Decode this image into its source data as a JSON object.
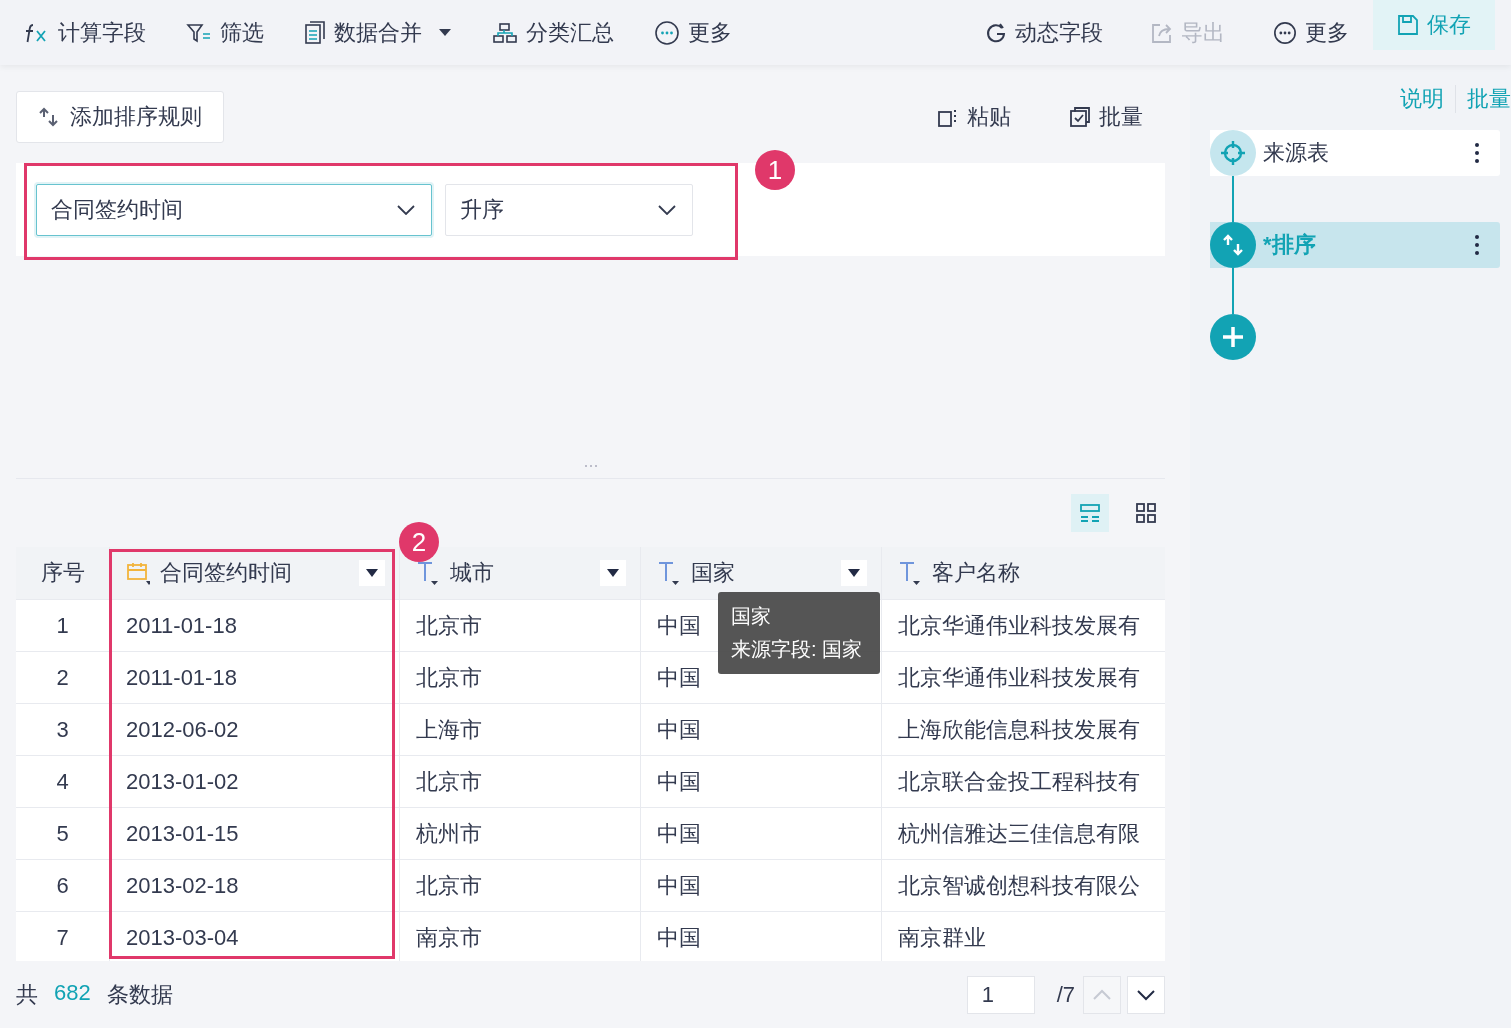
{
  "toolbar": {
    "left": [
      {
        "label": "计算字段",
        "dropdown": false
      },
      {
        "label": "筛选",
        "dropdown": false
      },
      {
        "label": "数据合并",
        "dropdown": true
      },
      {
        "label": "分类汇总",
        "dropdown": false
      },
      {
        "label": "更多",
        "dropdown": false
      }
    ],
    "right": [
      {
        "label": "动态字段",
        "disabled": false,
        "kind": "plain"
      },
      {
        "label": "导出",
        "disabled": true,
        "kind": "plain"
      },
      {
        "label": "更多",
        "disabled": false,
        "kind": "plain"
      },
      {
        "label": "保存",
        "disabled": false,
        "kind": "primary"
      }
    ]
  },
  "sort_panel": {
    "add_rule_button": "添加排序规则",
    "actions": [
      "粘贴",
      "批量"
    ],
    "rules": [
      {
        "field": {
          "value": "合同签约时间",
          "focused": true
        },
        "order": {
          "value": "升序",
          "focused": false
        }
      }
    ]
  },
  "view_toggles": [
    {
      "selected": true
    },
    {
      "selected": false
    }
  ],
  "table": {
    "columns": [
      {
        "label": "序号",
        "kind": "index",
        "menu": false
      },
      {
        "label": "合同签约时间",
        "kind": "date",
        "menu": true
      },
      {
        "label": "城市",
        "kind": "text",
        "menu": true
      },
      {
        "label": "国家",
        "kind": "text",
        "menu": true
      },
      {
        "label": "客户名称",
        "kind": "text",
        "menu": false
      }
    ],
    "rows": [
      [
        "1",
        "2011-01-18",
        "北京市",
        "中国",
        "北京华通伟业科技发展有"
      ],
      [
        "2",
        "2011-01-18",
        "北京市",
        "中国",
        "北京华通伟业科技发展有"
      ],
      [
        "3",
        "2012-06-02",
        "上海市",
        "中国",
        "上海欣能信息科技发展有"
      ],
      [
        "4",
        "2013-01-02",
        "北京市",
        "中国",
        "北京联合金投工程科技有"
      ],
      [
        "5",
        "2013-01-15",
        "杭州市",
        "中国",
        "杭州信雅达三佳信息有限"
      ],
      [
        "6",
        "2013-02-18",
        "北京市",
        "中国",
        "北京智诚创想科技有限公"
      ],
      [
        "7",
        "2013-03-04",
        "南京市",
        "中国",
        "南京群业"
      ]
    ]
  },
  "tooltip": {
    "title": "国家",
    "source": "来源字段: 国家"
  },
  "footer": {
    "prefix": "共",
    "count": "682",
    "suffix": "条数据",
    "page": "1",
    "total_pages": "/7",
    "prev_disabled": true,
    "next_disabled": false
  },
  "side_panel": {
    "links": [
      "说明",
      "批量"
    ],
    "steps": [
      {
        "label": "来源表",
        "selected": false
      },
      {
        "label": "*排序",
        "selected": true
      }
    ]
  },
  "annotations": [
    {
      "number": "1"
    },
    {
      "number": "2"
    }
  ]
}
